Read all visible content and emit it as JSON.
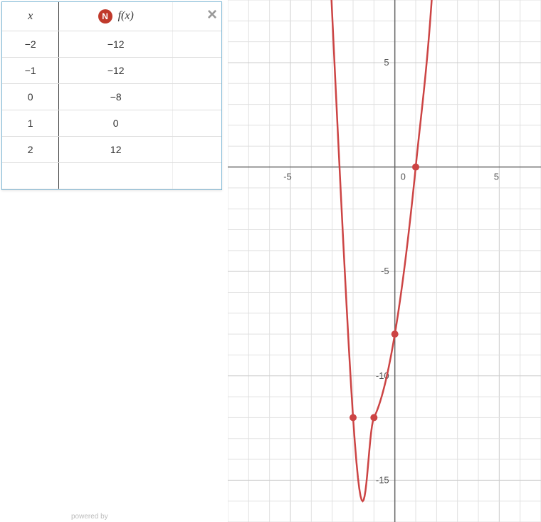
{
  "table": {
    "header_x": "x",
    "header_fx": "f(x)",
    "icon_letter": "N",
    "rows": [
      {
        "x": "−2",
        "fx": "−12"
      },
      {
        "x": "−1",
        "fx": "−12"
      },
      {
        "x": "0",
        "fx": "−8"
      },
      {
        "x": "1",
        "fx": "0"
      },
      {
        "x": "2",
        "fx": "12"
      }
    ]
  },
  "close_label": "×",
  "powered_by": "powered by",
  "chart_data": {
    "type": "line",
    "series": [
      {
        "name": "f(x)",
        "points": [
          {
            "x": -2,
            "y": -12
          },
          {
            "x": -1,
            "y": -12
          },
          {
            "x": 0,
            "y": -8
          },
          {
            "x": 1,
            "y": 0
          },
          {
            "x": 2,
            "y": 12
          }
        ]
      }
    ],
    "xlim": [
      -8,
      7
    ],
    "ylim": [
      -17,
      8
    ],
    "x_ticks": [
      -5,
      0,
      5
    ],
    "y_ticks": [
      5,
      -5,
      -10,
      -15
    ],
    "grid": true,
    "highlight_points": [
      {
        "x": -2,
        "y": -12
      },
      {
        "x": -1,
        "y": -12
      },
      {
        "x": 0,
        "y": -8
      },
      {
        "x": 1,
        "y": 0
      }
    ]
  }
}
